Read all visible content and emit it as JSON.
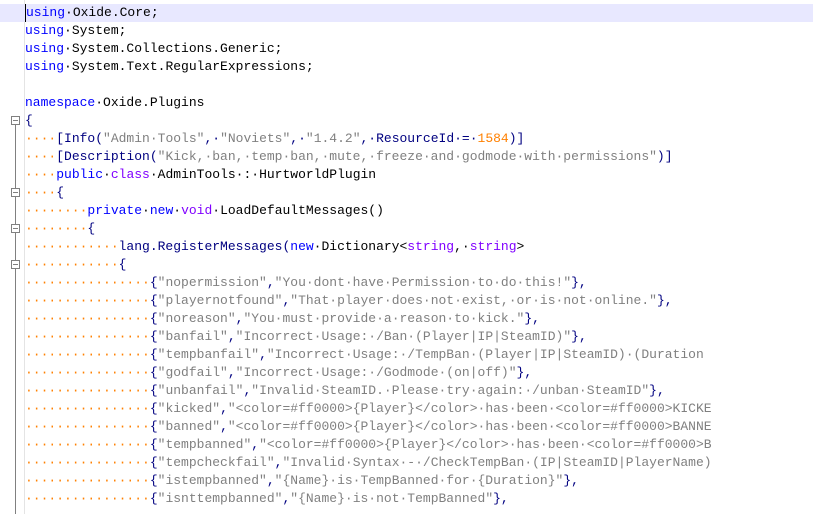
{
  "editor": {
    "lines": [
      [
        {
          "t": "using",
          "c": "k"
        },
        {
          "t": "·"
        },
        {
          "t": "Oxide.Core;"
        }
      ],
      [
        {
          "t": "using",
          "c": "k"
        },
        {
          "t": "·"
        },
        {
          "t": "System;"
        }
      ],
      [
        {
          "t": "using",
          "c": "k"
        },
        {
          "t": "·"
        },
        {
          "t": "System.Collections.Generic;"
        }
      ],
      [
        {
          "t": "using",
          "c": "k"
        },
        {
          "t": "·"
        },
        {
          "t": "System.Text.RegularExpressions;"
        }
      ],
      [],
      [
        {
          "t": "namespace",
          "c": "k"
        },
        {
          "t": "·"
        },
        {
          "t": "Oxide.Plugins"
        }
      ],
      [
        {
          "t": "{",
          "c": "o"
        }
      ],
      [
        {
          "t": "····",
          "c": "ws"
        },
        {
          "t": "[Info(",
          "c": "o"
        },
        {
          "t": "\"Admin·Tools\"",
          "c": "s"
        },
        {
          "t": ",·",
          "c": "o"
        },
        {
          "t": "\"Noviets\"",
          "c": "s"
        },
        {
          "t": ",·",
          "c": "o"
        },
        {
          "t": "\"1.4.2\"",
          "c": "s"
        },
        {
          "t": ",·ResourceId·=·",
          "c": "o"
        },
        {
          "t": "1584",
          "c": "n"
        },
        {
          "t": ")]",
          "c": "o"
        }
      ],
      [
        {
          "t": "····",
          "c": "ws"
        },
        {
          "t": "[Description(",
          "c": "o"
        },
        {
          "t": "\"Kick,·ban,·temp·ban,·mute,·freeze·and·godmode·with·permissions\"",
          "c": "s"
        },
        {
          "t": ")]",
          "c": "o"
        }
      ],
      [
        {
          "t": "····",
          "c": "ws"
        },
        {
          "t": "public",
          "c": "k"
        },
        {
          "t": "·"
        },
        {
          "t": "class",
          "c": "k2"
        },
        {
          "t": "·AdminTools·:·HurtworldPlugin"
        }
      ],
      [
        {
          "t": "····",
          "c": "ws"
        },
        {
          "t": "{",
          "c": "o"
        }
      ],
      [
        {
          "t": "········",
          "c": "ws"
        },
        {
          "t": "private",
          "c": "k"
        },
        {
          "t": "·"
        },
        {
          "t": "new",
          "c": "k"
        },
        {
          "t": "·"
        },
        {
          "t": "void",
          "c": "k2"
        },
        {
          "t": "·LoadDefaultMessages()"
        }
      ],
      [
        {
          "t": "········",
          "c": "ws"
        },
        {
          "t": "{",
          "c": "o"
        }
      ],
      [
        {
          "t": "············",
          "c": "ws"
        },
        {
          "t": "lang.RegisterMessages(",
          "c": "o"
        },
        {
          "t": "new",
          "c": "k"
        },
        {
          "t": "·Dictionary<"
        },
        {
          "t": "string",
          "c": "k2"
        },
        {
          "t": ",·"
        },
        {
          "t": "string",
          "c": "k2"
        },
        {
          "t": ">"
        }
      ],
      [
        {
          "t": "············",
          "c": "ws"
        },
        {
          "t": "{",
          "c": "o"
        }
      ],
      [
        {
          "t": "················",
          "c": "ws"
        },
        {
          "t": "{",
          "c": "o"
        },
        {
          "t": "\"nopermission\"",
          "c": "s"
        },
        {
          "t": ",",
          "c": "o"
        },
        {
          "t": "\"You·dont·have·Permission·to·do·this!\"",
          "c": "s"
        },
        {
          "t": "},",
          "c": "o"
        }
      ],
      [
        {
          "t": "················",
          "c": "ws"
        },
        {
          "t": "{",
          "c": "o"
        },
        {
          "t": "\"playernotfound\"",
          "c": "s"
        },
        {
          "t": ",",
          "c": "o"
        },
        {
          "t": "\"That·player·does·not·exist,·or·is·not·online.\"",
          "c": "s"
        },
        {
          "t": "},",
          "c": "o"
        }
      ],
      [
        {
          "t": "················",
          "c": "ws"
        },
        {
          "t": "{",
          "c": "o"
        },
        {
          "t": "\"noreason\"",
          "c": "s"
        },
        {
          "t": ",",
          "c": "o"
        },
        {
          "t": "\"You·must·provide·a·reason·to·kick.\"",
          "c": "s"
        },
        {
          "t": "},",
          "c": "o"
        }
      ],
      [
        {
          "t": "················",
          "c": "ws"
        },
        {
          "t": "{",
          "c": "o"
        },
        {
          "t": "\"banfail\"",
          "c": "s"
        },
        {
          "t": ",",
          "c": "o"
        },
        {
          "t": "\"Incorrect·Usage:·/Ban·(Player|IP|SteamID)\"",
          "c": "s"
        },
        {
          "t": "},",
          "c": "o"
        }
      ],
      [
        {
          "t": "················",
          "c": "ws"
        },
        {
          "t": "{",
          "c": "o"
        },
        {
          "t": "\"tempbanfail\"",
          "c": "s"
        },
        {
          "t": ",",
          "c": "o"
        },
        {
          "t": "\"Incorrect·Usage:·/TempBan·(Player|IP|SteamID)·(Duration",
          "c": "s"
        }
      ],
      [
        {
          "t": "················",
          "c": "ws"
        },
        {
          "t": "{",
          "c": "o"
        },
        {
          "t": "\"godfail\"",
          "c": "s"
        },
        {
          "t": ",",
          "c": "o"
        },
        {
          "t": "\"Incorrect·Usage:·/Godmode·(on|off)\"",
          "c": "s"
        },
        {
          "t": "},",
          "c": "o"
        }
      ],
      [
        {
          "t": "················",
          "c": "ws"
        },
        {
          "t": "{",
          "c": "o"
        },
        {
          "t": "\"unbanfail\"",
          "c": "s"
        },
        {
          "t": ",",
          "c": "o"
        },
        {
          "t": "\"Invalid·SteamID.·Please·try·again:·/unban·SteamID\"",
          "c": "s"
        },
        {
          "t": "},",
          "c": "o"
        }
      ],
      [
        {
          "t": "················",
          "c": "ws"
        },
        {
          "t": "{",
          "c": "o"
        },
        {
          "t": "\"kicked\"",
          "c": "s"
        },
        {
          "t": ",",
          "c": "o"
        },
        {
          "t": "\"<color=#ff0000>{Player}</color>·has·been·<color=#ff0000>KICKE",
          "c": "s"
        }
      ],
      [
        {
          "t": "················",
          "c": "ws"
        },
        {
          "t": "{",
          "c": "o"
        },
        {
          "t": "\"banned\"",
          "c": "s"
        },
        {
          "t": ",",
          "c": "o"
        },
        {
          "t": "\"<color=#ff0000>{Player}</color>·has·been·<color=#ff0000>BANNE",
          "c": "s"
        }
      ],
      [
        {
          "t": "················",
          "c": "ws"
        },
        {
          "t": "{",
          "c": "o"
        },
        {
          "t": "\"tempbanned\"",
          "c": "s"
        },
        {
          "t": ",",
          "c": "o"
        },
        {
          "t": "\"<color=#ff0000>{Player}</color>·has·been·<color=#ff0000>B",
          "c": "s"
        }
      ],
      [
        {
          "t": "················",
          "c": "ws"
        },
        {
          "t": "{",
          "c": "o"
        },
        {
          "t": "\"tempcheckfail\"",
          "c": "s"
        },
        {
          "t": ",",
          "c": "o"
        },
        {
          "t": "\"Invalid·Syntax·-·/CheckTempBan·(IP|SteamID|PlayerName)",
          "c": "s"
        }
      ],
      [
        {
          "t": "················",
          "c": "ws"
        },
        {
          "t": "{",
          "c": "o"
        },
        {
          "t": "\"istempbanned\"",
          "c": "s"
        },
        {
          "t": ",",
          "c": "o"
        },
        {
          "t": "\"{Name}·is·TempBanned·for·{Duration}\"",
          "c": "s"
        },
        {
          "t": "},",
          "c": "o"
        }
      ],
      [
        {
          "t": "················",
          "c": "ws"
        },
        {
          "t": "{",
          "c": "o"
        },
        {
          "t": "\"isnttempbanned\"",
          "c": "s"
        },
        {
          "t": ",",
          "c": "o"
        },
        {
          "t": "\"{Name}·is·not·TempBanned\"",
          "c": "s"
        },
        {
          "t": "},",
          "c": "o"
        }
      ]
    ],
    "fold_markers": [
      6,
      10,
      12,
      14
    ],
    "colors": {
      "keyword": "#0000ff",
      "type_keyword": "#8000ff",
      "string": "#808080",
      "number": "#ff8000",
      "operator": "#000080",
      "whitespace_dot": "#ff8000",
      "current_line": "#e8e8ff",
      "fold_box": "#808080"
    },
    "icons": {
      "fold": "fold-minus-icon"
    }
  }
}
